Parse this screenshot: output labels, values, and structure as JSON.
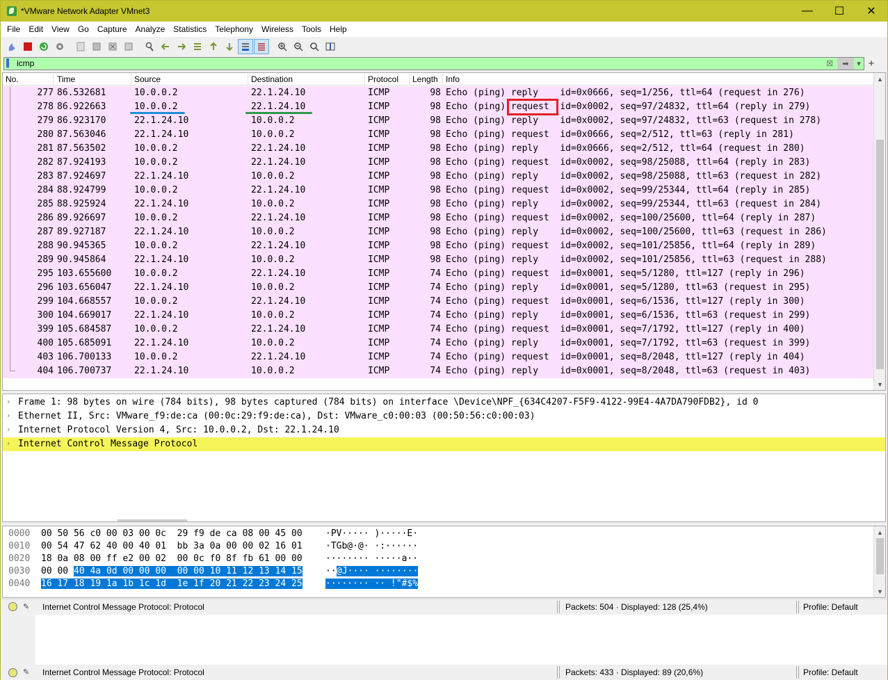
{
  "window": {
    "title": "*VMware Network Adapter VMnet3",
    "controls": [
      "—",
      "☐",
      "✕"
    ]
  },
  "menu": [
    "File",
    "Edit",
    "View",
    "Go",
    "Capture",
    "Analyze",
    "Statistics",
    "Telephony",
    "Wireless",
    "Tools",
    "Help"
  ],
  "filter": {
    "value": "icmp"
  },
  "columns": [
    "No.",
    "Time",
    "Source",
    "Destination",
    "Protocol",
    "Length",
    "Info"
  ],
  "packets": [
    {
      "no": "277",
      "time": "86.532681",
      "src": "10.0.0.2",
      "dst": "22.1.24.10",
      "proto": "ICMP",
      "len": "98",
      "info": "Echo (ping) reply    id=0x0666, seq=1/256, ttl=64 (request in 276)"
    },
    {
      "no": "278",
      "time": "86.922663",
      "src": "10.0.0.2",
      "dst": "22.1.24.10",
      "proto": "ICMP",
      "len": "98",
      "info": "Echo (ping) request  id=0x0002, seq=97/24832, ttl=64 (reply in 279)"
    },
    {
      "no": "279",
      "time": "86.923170",
      "src": "22.1.24.10",
      "dst": "10.0.0.2",
      "proto": "ICMP",
      "len": "98",
      "info": "Echo (ping) reply    id=0x0002, seq=97/24832, ttl=63 (request in 278)"
    },
    {
      "no": "280",
      "time": "87.563046",
      "src": "22.1.24.10",
      "dst": "10.0.0.2",
      "proto": "ICMP",
      "len": "98",
      "info": "Echo (ping) request  id=0x0666, seq=2/512, ttl=63 (reply in 281)"
    },
    {
      "no": "281",
      "time": "87.563502",
      "src": "10.0.0.2",
      "dst": "22.1.24.10",
      "proto": "ICMP",
      "len": "98",
      "info": "Echo (ping) reply    id=0x0666, seq=2/512, ttl=64 (request in 280)"
    },
    {
      "no": "282",
      "time": "87.924193",
      "src": "10.0.0.2",
      "dst": "22.1.24.10",
      "proto": "ICMP",
      "len": "98",
      "info": "Echo (ping) request  id=0x0002, seq=98/25088, ttl=64 (reply in 283)"
    },
    {
      "no": "283",
      "time": "87.924697",
      "src": "22.1.24.10",
      "dst": "10.0.0.2",
      "proto": "ICMP",
      "len": "98",
      "info": "Echo (ping) reply    id=0x0002, seq=98/25088, ttl=63 (request in 282)"
    },
    {
      "no": "284",
      "time": "88.924799",
      "src": "10.0.0.2",
      "dst": "22.1.24.10",
      "proto": "ICMP",
      "len": "98",
      "info": "Echo (ping) request  id=0x0002, seq=99/25344, ttl=64 (reply in 285)"
    },
    {
      "no": "285",
      "time": "88.925924",
      "src": "22.1.24.10",
      "dst": "10.0.0.2",
      "proto": "ICMP",
      "len": "98",
      "info": "Echo (ping) reply    id=0x0002, seq=99/25344, ttl=63 (request in 284)"
    },
    {
      "no": "286",
      "time": "89.926697",
      "src": "10.0.0.2",
      "dst": "22.1.24.10",
      "proto": "ICMP",
      "len": "98",
      "info": "Echo (ping) request  id=0x0002, seq=100/25600, ttl=64 (reply in 287)"
    },
    {
      "no": "287",
      "time": "89.927187",
      "src": "22.1.24.10",
      "dst": "10.0.0.2",
      "proto": "ICMP",
      "len": "98",
      "info": "Echo (ping) reply    id=0x0002, seq=100/25600, ttl=63 (request in 286)"
    },
    {
      "no": "288",
      "time": "90.945365",
      "src": "10.0.0.2",
      "dst": "22.1.24.10",
      "proto": "ICMP",
      "len": "98",
      "info": "Echo (ping) request  id=0x0002, seq=101/25856, ttl=64 (reply in 289)"
    },
    {
      "no": "289",
      "time": "90.945864",
      "src": "22.1.24.10",
      "dst": "10.0.0.2",
      "proto": "ICMP",
      "len": "98",
      "info": "Echo (ping) reply    id=0x0002, seq=101/25856, ttl=63 (request in 288)"
    },
    {
      "no": "295",
      "time": "103.655600",
      "src": "10.0.0.2",
      "dst": "22.1.24.10",
      "proto": "ICMP",
      "len": "74",
      "info": "Echo (ping) request  id=0x0001, seq=5/1280, ttl=127 (reply in 296)"
    },
    {
      "no": "296",
      "time": "103.656047",
      "src": "22.1.24.10",
      "dst": "10.0.0.2",
      "proto": "ICMP",
      "len": "74",
      "info": "Echo (ping) reply    id=0x0001, seq=5/1280, ttl=63 (request in 295)"
    },
    {
      "no": "299",
      "time": "104.668557",
      "src": "10.0.0.2",
      "dst": "22.1.24.10",
      "proto": "ICMP",
      "len": "74",
      "info": "Echo (ping) request  id=0x0001, seq=6/1536, ttl=127 (reply in 300)"
    },
    {
      "no": "300",
      "time": "104.669017",
      "src": "22.1.24.10",
      "dst": "10.0.0.2",
      "proto": "ICMP",
      "len": "74",
      "info": "Echo (ping) reply    id=0x0001, seq=6/1536, ttl=63 (request in 299)"
    },
    {
      "no": "399",
      "time": "105.684587",
      "src": "10.0.0.2",
      "dst": "22.1.24.10",
      "proto": "ICMP",
      "len": "74",
      "info": "Echo (ping) request  id=0x0001, seq=7/1792, ttl=127 (reply in 400)"
    },
    {
      "no": "400",
      "time": "105.685091",
      "src": "22.1.24.10",
      "dst": "10.0.0.2",
      "proto": "ICMP",
      "len": "74",
      "info": "Echo (ping) reply    id=0x0001, seq=7/1792, ttl=63 (request in 399)"
    },
    {
      "no": "403",
      "time": "106.700133",
      "src": "10.0.0.2",
      "dst": "22.1.24.10",
      "proto": "ICMP",
      "len": "74",
      "info": "Echo (ping) request  id=0x0001, seq=8/2048, ttl=127 (reply in 404)"
    },
    {
      "no": "404",
      "time": "106.700737",
      "src": "22.1.24.10",
      "dst": "10.0.0.2",
      "proto": "ICMP",
      "len": "74",
      "info": "Echo (ping) reply    id=0x0001, seq=8/2048, ttl=63 (request in 403)"
    }
  ],
  "details": [
    "Frame 1: 98 bytes on wire (784 bits), 98 bytes captured (784 bits) on interface \\Device\\NPF_{634C4207-F5F9-4122-99E4-4A7DA790FDB2}, id 0",
    "Ethernet II, Src: VMware_f9:de:ca (00:0c:29:f9:de:ca), Dst: VMware_c0:00:03 (00:50:56:c0:00:03)",
    "Internet Protocol Version 4, Src: 10.0.0.2, Dst: 22.1.24.10",
    "Internet Control Message Protocol"
  ],
  "bytes": [
    {
      "off": "0000",
      "hex_a": "00 50 56 c0 00 03 00 0c  29 f9 de ca 08 00 45 00",
      "hex_b": "",
      "ascii_a": "·PV····· )·····E·",
      "ascii_b": ""
    },
    {
      "off": "0010",
      "hex_a": "00 54 47 62 40 00 40 01  bb 3a 0a 00 00 02 16 01",
      "hex_b": "",
      "ascii_a": "·TGb@·@· ·:······",
      "ascii_b": ""
    },
    {
      "off": "0020",
      "hex_a": "18 0a 08 00 ff e2 00 02  00 0c f0 8f fb 61 00 00",
      "hex_b": "",
      "ascii_a": "········ ·····a··",
      "ascii_b": ""
    },
    {
      "off": "0030",
      "hex_a": "00 00 ",
      "hex_b": "40 4a 0d 00 00 00  00 00 10 11 12 13 14 15",
      "ascii_a": "··",
      "ascii_b": "@J···· ········"
    },
    {
      "off": "0040",
      "hex_a": "",
      "hex_b": "16 17 18 19 1a 1b 1c 1d  1e 1f 20 21 22 23 24 25",
      "ascii_a": "",
      "ascii_b": "········ ·· !\"#$%"
    }
  ],
  "status": {
    "message": "Internet Control Message Protocol: Protocol",
    "packets": "Packets: 504 · Displayed: 128 (25,4%)",
    "profile": "Profile: Default"
  },
  "status2": {
    "message": "Internet Control Message Protocol: Protocol",
    "packets": "Packets: 433 · Displayed: 89 (20,6%)",
    "profile": "Profile: Default"
  }
}
